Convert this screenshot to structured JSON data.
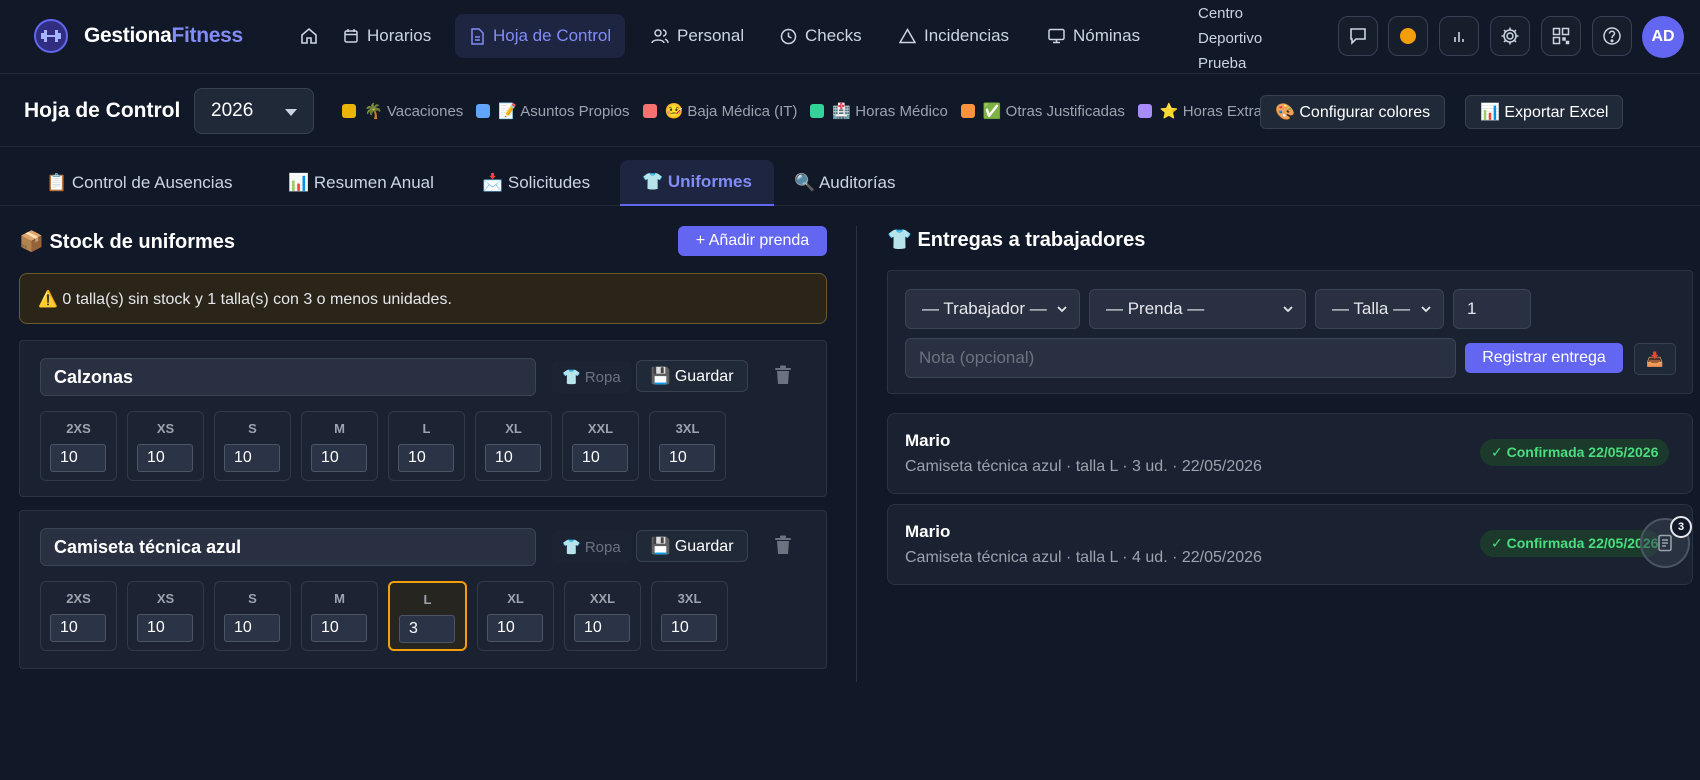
{
  "brand": {
    "name_part1": "Gestiona",
    "name_part2": "Fitness"
  },
  "nav": {
    "items": [
      {
        "label": "Horarios"
      },
      {
        "label": "Hoja de Control",
        "active": true
      },
      {
        "label": "Personal"
      },
      {
        "label": "Checks"
      },
      {
        "label": "Incidencias"
      },
      {
        "label": "Nóminas"
      }
    ],
    "center_line1": "Centro",
    "center_line2": "Deportivo",
    "center_line3": "Prueba",
    "avatar": "AD",
    "toolbar_icons": [
      "chat-icon",
      "emoji-icon",
      "bar-chart-icon",
      "gear-icon",
      "qr-code-icon",
      "help-icon"
    ]
  },
  "header": {
    "title": "Hoja de Control",
    "year": "2026",
    "legend": [
      {
        "label": "🌴 Vacaciones",
        "color": "#eab308"
      },
      {
        "label": "📝 Asuntos Propios",
        "color": "#60a5fa"
      },
      {
        "label": "🤒 Baja Médica (IT)",
        "color": "#f87171"
      },
      {
        "label": "🏥 Horas Médico",
        "color": "#34d399"
      },
      {
        "label": "✅ Otras Justificadas",
        "color": "#fb923c"
      },
      {
        "label": "⭐ Horas Extra",
        "color": "#a78bfa"
      }
    ],
    "configure_colors": "🎨 Configurar colores",
    "export_excel": "📊 Exportar Excel"
  },
  "tabs": [
    {
      "label": "📋 Control de Ausencias"
    },
    {
      "label": "📊 Resumen Anual"
    },
    {
      "label": "📩 Solicitudes"
    },
    {
      "label": "👕 Uniformes",
      "active": true
    },
    {
      "label": "🔍 Auditorías"
    }
  ],
  "stock": {
    "title": "📦 Stock de uniformes",
    "add_button": "+ Añadir prenda",
    "warning": "⚠️ 0 talla(s) sin stock y 1 talla(s) con 3 o menos unidades.",
    "garments": [
      {
        "name": "Calzonas",
        "category": "👕 Ropa",
        "save": "💾 Guardar",
        "sizes": [
          {
            "label": "2XS",
            "qty": "10"
          },
          {
            "label": "XS",
            "qty": "10"
          },
          {
            "label": "S",
            "qty": "10"
          },
          {
            "label": "M",
            "qty": "10"
          },
          {
            "label": "L",
            "qty": "10"
          },
          {
            "label": "XL",
            "qty": "10"
          },
          {
            "label": "XXL",
            "qty": "10"
          },
          {
            "label": "3XL",
            "qty": "10"
          }
        ]
      },
      {
        "name": "Camiseta técnica azul",
        "category": "👕 Ropa",
        "save": "💾 Guardar",
        "sizes": [
          {
            "label": "2XS",
            "qty": "10"
          },
          {
            "label": "XS",
            "qty": "10"
          },
          {
            "label": "S",
            "qty": "10"
          },
          {
            "label": "M",
            "qty": "10"
          },
          {
            "label": "L",
            "qty": "3",
            "low": true
          },
          {
            "label": "XL",
            "qty": "10"
          },
          {
            "label": "XXL",
            "qty": "10"
          },
          {
            "label": "3XL",
            "qty": "10"
          }
        ]
      }
    ]
  },
  "deliveries": {
    "title": "👕 Entregas a trabajadores",
    "form": {
      "worker": "— Trabajador —",
      "garment": "— Prenda —",
      "size": "— Talla —",
      "quantity": "1",
      "note_placeholder": "Nota (opcional)",
      "register": "Registrar entrega",
      "tray": "📥"
    },
    "list": [
      {
        "name": "Mario",
        "detail": "Camiseta técnica azul · talla L · 3 ud. · 22/05/2026",
        "status": "✓ Confirmada 22/05/2026"
      },
      {
        "name": "Mario",
        "detail": "Camiseta técnica azul · talla L · 4 ud. · 22/05/2026",
        "status": "✓ Confirmada 22/05/2026"
      }
    ]
  },
  "floating_badge": {
    "count": "3"
  }
}
